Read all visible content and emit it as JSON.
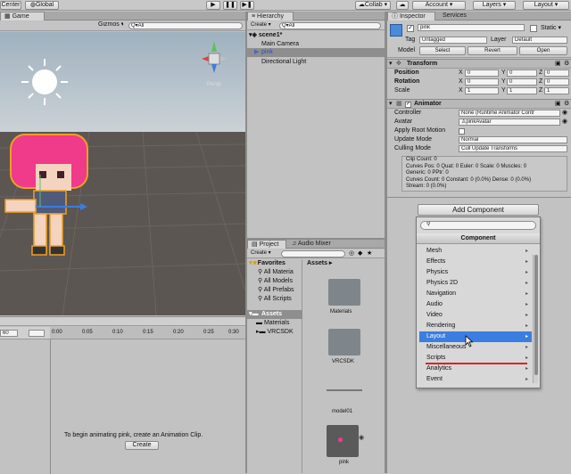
{
  "toolbar": {
    "center": "Center",
    "global": "Global",
    "collab": "Collab ▾",
    "account": "Account ▾",
    "layers": "Layers ▾",
    "layout": "Layout ▾"
  },
  "game_tab": "Game",
  "scene_view": {
    "gizmos": "Gizmos ▾",
    "search": "Q▾All",
    "persp": "Persp"
  },
  "hierarchy": {
    "tab": "Hierarchy",
    "create": "Create ▾",
    "search": "Q▾All",
    "scene": "scene1*",
    "items": [
      "Main Camera",
      "pink",
      "Directional Light"
    ]
  },
  "inspector": {
    "tab": "Inspector",
    "services_tab": "Services",
    "object_name": "pink",
    "static_label": "Static ▾",
    "tag_label": "Tag",
    "tag_value": "Untagged",
    "layer_label": "Layer",
    "layer_value": "Default",
    "model_label": "Model",
    "select": "Select",
    "revert": "Revert",
    "open": "Open",
    "transform": {
      "title": "Transform",
      "position": "Position",
      "rotation": "Rotation",
      "scale": "Scale",
      "x": "X",
      "y": "Y",
      "z": "Z",
      "pos": [
        "0",
        "0",
        "0"
      ],
      "rot": [
        "0",
        "0",
        "0"
      ],
      "scl": [
        "1",
        "1",
        "1"
      ]
    },
    "animator": {
      "title": "Animator",
      "controller_label": "Controller",
      "controller_value": "None (Runtime Animator Contr",
      "avatar_label": "Avatar",
      "avatar_value": "pinkAvatar",
      "root_motion_label": "Apply Root Motion",
      "update_mode_label": "Update Mode",
      "update_mode_value": "Normal",
      "culling_label": "Culling Mode",
      "culling_value": "Cull Update Transforms",
      "info": [
        "Clip Count: 0",
        "Curves Pos: 0 Quat: 0 Euler: 0 Scale: 0 Muscles: 0",
        "Generic: 0 PPtr: 0",
        "Curves Count: 0 Constant: 0 (0.0%) Dense: 0 (0.0%)",
        "Stream: 0 (0.0%)"
      ]
    },
    "add_component": "Add Component",
    "component_menu_title": "Component",
    "menu_items": [
      "Mesh",
      "Effects",
      "Physics",
      "Physics 2D",
      "Navigation",
      "Audio",
      "Video",
      "Rendering",
      "Layout",
      "Miscellaneous",
      "Scripts",
      "Analytics",
      "Event"
    ]
  },
  "project": {
    "tab": "Project",
    "audio_tab": "Audio Mixer",
    "create": "Create ▾",
    "favorites": "Favorites",
    "fav_items": [
      "All Materia",
      "All Models",
      "All Prefabs",
      "All Scripts"
    ],
    "assets_label": "Assets",
    "asset_tree": [
      "Materials",
      "VRCSDK"
    ],
    "breadcrumb": "Assets ▸",
    "grid_items": [
      "Materials",
      "VRCSDK",
      "model01",
      "pink"
    ]
  },
  "animation": {
    "frame": "60",
    "ticks": [
      "0:00",
      "0:05",
      "0:10",
      "0:15",
      "0:20",
      "0:25",
      "0:30",
      "0:35"
    ],
    "message": "To begin animating pink, create an Animation Clip.",
    "create": "Create"
  },
  "colors": {
    "selection": "#3b7de0",
    "annotation_line": "#e02020",
    "scene_sky": "#a9b8c4",
    "scene_ground": "#5a5550"
  }
}
